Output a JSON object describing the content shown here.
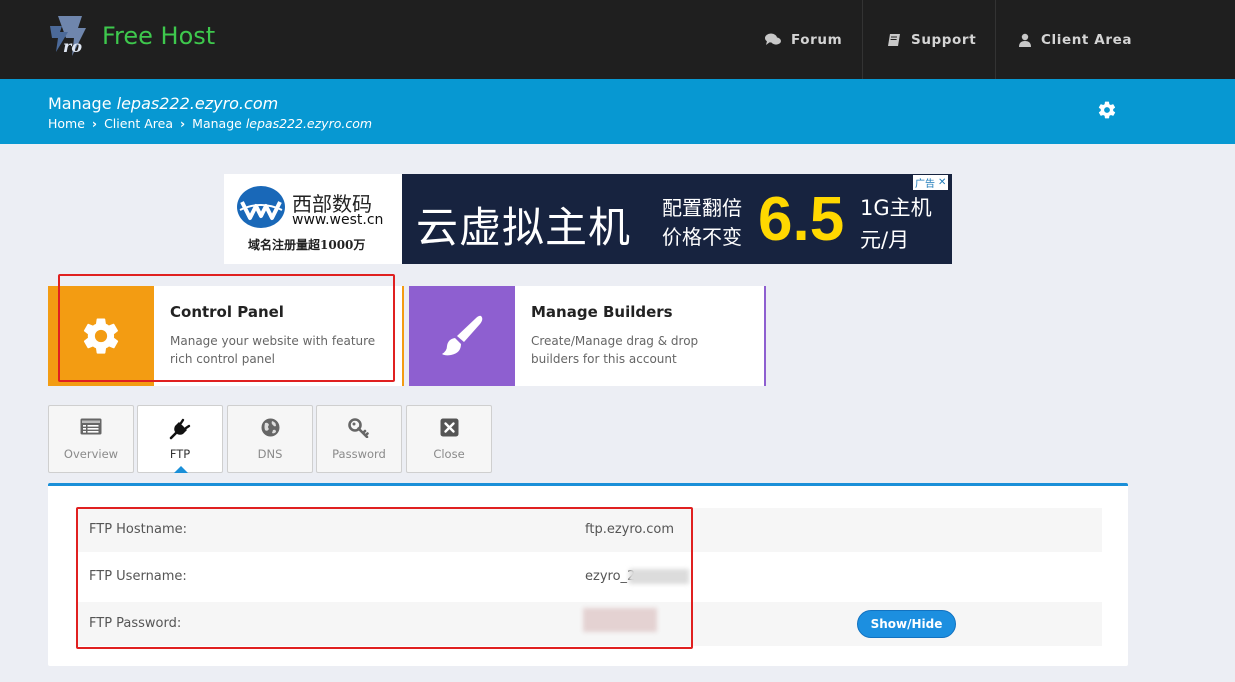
{
  "brand": {
    "name": "Free Host",
    "accent": "#3ec84d"
  },
  "nav": [
    {
      "label": "Forum",
      "icon": "comments-icon"
    },
    {
      "label": "Support",
      "icon": "book-icon"
    },
    {
      "label": "Client Area",
      "icon": "user-icon"
    }
  ],
  "header": {
    "title_prefix": "Manage ",
    "title_domain": "lepas222.ezyro.com",
    "breadcrumbs": {
      "home": "Home",
      "client_area": "Client Area",
      "current_prefix": "Manage ",
      "current_domain": "lepas222.ezyro.com"
    },
    "bg_color": "#0798d2"
  },
  "ad": {
    "brand_name": "西部数码",
    "brand_url": "www.west.cn",
    "tagline": "域名注册量超1000万",
    "headline": "云虚拟主机",
    "sub1": "配置翻倍",
    "sub2": "价格不变",
    "price": "6.5",
    "plan1": "1G主机",
    "plan2": "元/月",
    "badge": "广告",
    "close": "✕"
  },
  "cards": {
    "control_panel": {
      "title": "Control Panel",
      "desc": "Manage your website with feature rich control panel",
      "color": "#f39c12"
    },
    "manage_builders": {
      "title": "Manage Builders",
      "desc": "Create/Manage drag & drop builders for this account",
      "color": "#8e5fd0"
    }
  },
  "tabs": [
    {
      "label": "Overview",
      "icon": "list-icon",
      "active": false
    },
    {
      "label": "FTP",
      "icon": "plug-icon",
      "active": true
    },
    {
      "label": "DNS",
      "icon": "globe-icon",
      "active": false
    },
    {
      "label": "Password",
      "icon": "key-icon",
      "active": false
    },
    {
      "label": "Close",
      "icon": "close-box-icon",
      "active": false
    }
  ],
  "ftp": {
    "hostname_label": "FTP Hostname:",
    "hostname_value": "ftp.ezyro.com",
    "username_label": "FTP Username:",
    "username_value": "ezyro_2",
    "password_label": "FTP Password:",
    "show_hide_label": "Show/Hide"
  }
}
